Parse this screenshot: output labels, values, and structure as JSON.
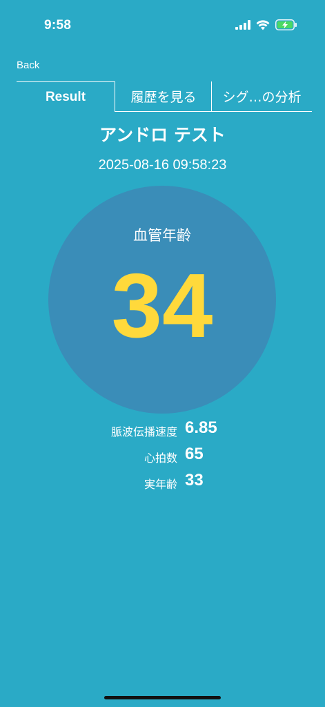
{
  "status_bar": {
    "time": "9:58"
  },
  "nav": {
    "back_label": "Back"
  },
  "tabs": [
    {
      "label": "Result"
    },
    {
      "label": "履歴を見る"
    },
    {
      "label": "シグ…の分析"
    }
  ],
  "test": {
    "title": "アンドロ テスト",
    "timestamp": "2025-08-16 09:58:23"
  },
  "vascular_age": {
    "label": "血管年齢",
    "value": "34"
  },
  "metrics": [
    {
      "label": "脈波伝播速度",
      "value": "6.85"
    },
    {
      "label": "心拍数",
      "value": "65"
    },
    {
      "label": "実年齢",
      "value": "33"
    }
  ],
  "colors": {
    "background": "#2AAAC6",
    "circle": "#3A8DB8",
    "age_value": "#FFD93B",
    "battery_charging": "#4CD964"
  }
}
